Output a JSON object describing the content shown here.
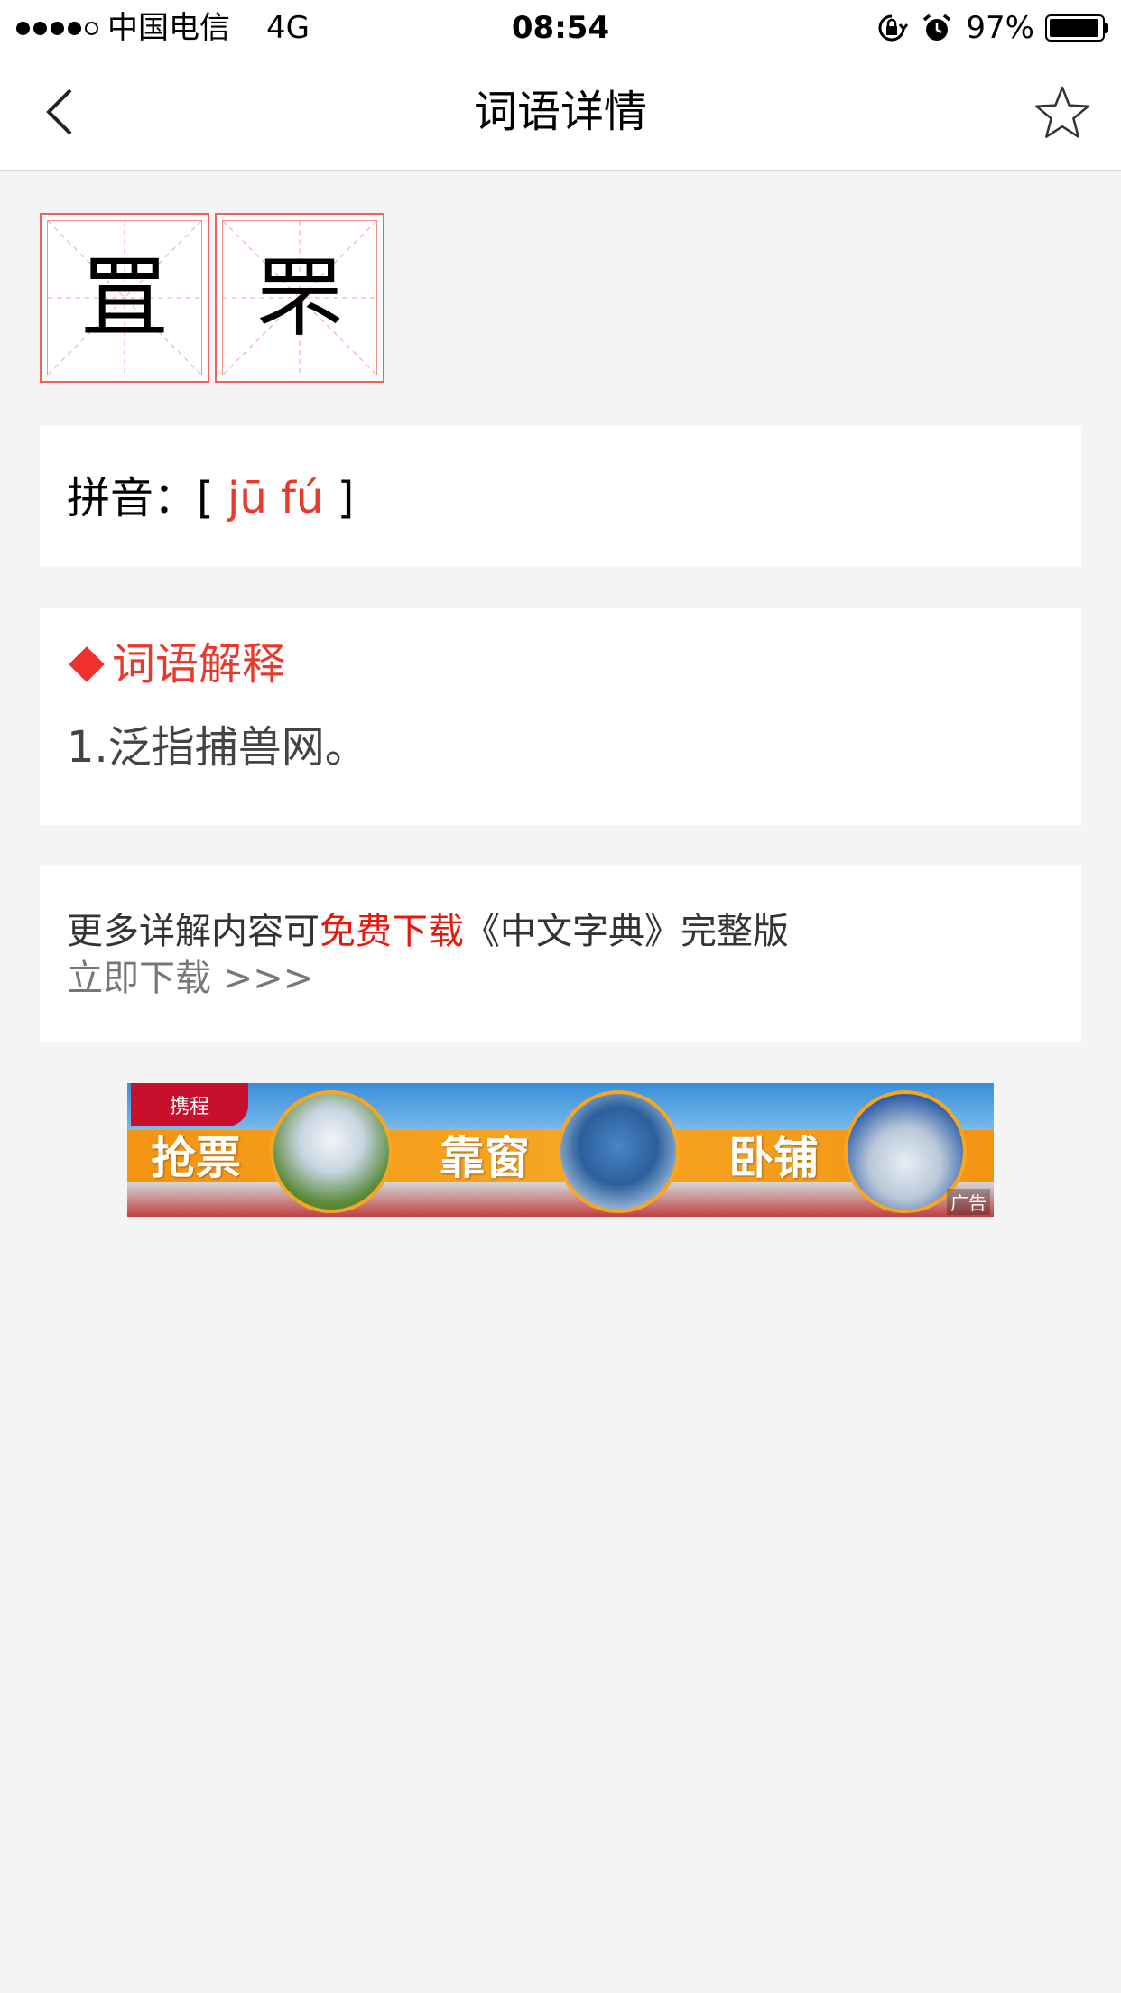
{
  "status_bar": {
    "carrier": "中国电信",
    "network": "4G",
    "time": "08:54",
    "battery_percent": "97%",
    "battery_level": 0.97,
    "icons": [
      "signal-icon",
      "orientation-lock-icon",
      "alarm-icon",
      "battery-icon"
    ]
  },
  "nav": {
    "title": "词语详情",
    "back_icon": "chevron-left-icon",
    "favorite_icon": "star-outline-icon"
  },
  "word": {
    "characters": [
      "罝",
      "罘"
    ]
  },
  "pinyin": {
    "label": "拼音：",
    "open_bracket": "[",
    "value": "jū fú",
    "close_bracket": "]"
  },
  "explanation": {
    "heading": "词语解释",
    "items": [
      "1.泛指捕兽网。"
    ]
  },
  "download": {
    "prefix": "更多详解内容可",
    "link_text": "免费下载",
    "suffix": "《中文字典》完整版",
    "action": "立即下载 >>>"
  },
  "ad": {
    "brand": "携程",
    "labels": [
      "抢票",
      "靠窗",
      "卧铺"
    ],
    "tag": "广告"
  },
  "colors": {
    "accent_red": "#e8392c",
    "grid_red": "#f06060",
    "background": "#f4f4f4",
    "ad_orange": "#f39412"
  }
}
